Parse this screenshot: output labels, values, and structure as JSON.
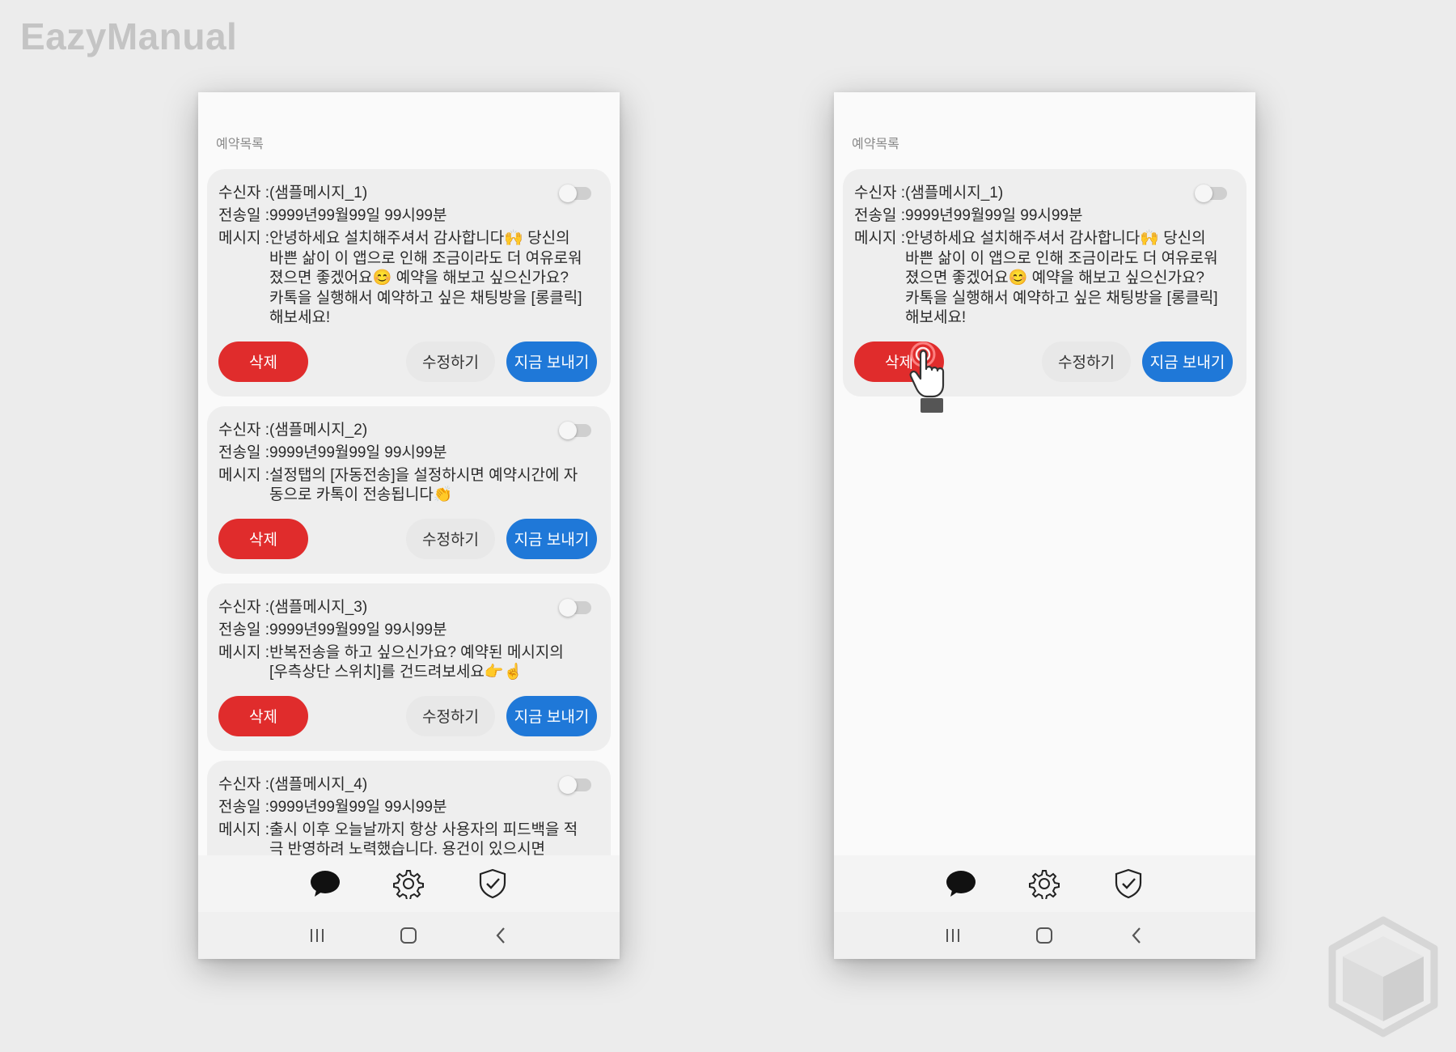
{
  "watermark": "EazyManual",
  "list_title": "예약목록",
  "labels": {
    "recipient": "수신자 : ",
    "date": "전송일 : ",
    "message": "메시지 : "
  },
  "buttons": {
    "delete": "삭제",
    "edit": "수정하기",
    "send_now": "지금 보내기"
  },
  "colors": {
    "delete": "#e02c2c",
    "send_now": "#1f78d8",
    "edit": "#e8e8e8"
  },
  "left_phone": {
    "cards": [
      {
        "recipient": "(샘플메시지_1)",
        "date": "9999년99월99일 99시99분",
        "message": "안녕하세요 설치해주셔서 감사합니다🙌 당신의 바쁜 삶이 이 앱으로 인해 조금이라도 더 여유로워졌으면 좋겠어요😊 예약을 해보고 싶으신가요? 카톡을 실행해서 예약하고 싶은 채팅방을 [롱클릭] 해보세요!",
        "toggle_on": false
      },
      {
        "recipient": "(샘플메시지_2)",
        "date": "9999년99월99일 99시99분",
        "message": "설정탭의 [자동전송]을 설정하시면 예약시간에 자동으로 카톡이 전송됩니다👏",
        "toggle_on": false
      },
      {
        "recipient": "(샘플메시지_3)",
        "date": "9999년99월99일 99시99분",
        "message": "반복전송을 하고 싶으신가요? 예약된 메시지의 [우측상단 스위치]를 건드려보세요👉☝",
        "toggle_on": false
      },
      {
        "recipient": "(샘플메시지_4)",
        "date": "9999년99월99일 99시99분",
        "message": "출시 이후 오늘날까지 항상 사용자의 피드백을 적극 반영하려 노력했습니다. 용건이 있으시면",
        "toggle_on": false
      }
    ]
  },
  "right_phone": {
    "cards": [
      {
        "recipient": "(샘플메시지_1)",
        "date": "9999년99월99일 99시99분",
        "message": "안녕하세요 설치해주셔서 감사합니다🙌 당신의 바쁜 삶이 이 앱으로 인해 조금이라도 더 여유로워졌으면 좋겠어요😊 예약을 해보고 싶으신가요? 카톡을 실행해서 예약하고 싶은 채팅방을 [롱클릭] 해보세요!",
        "toggle_on": false
      }
    ]
  },
  "bottom_nav": [
    "chat-bubble-icon",
    "gear-icon",
    "shield-check-icon"
  ],
  "system_nav": [
    "recent-apps-icon",
    "home-icon",
    "back-icon"
  ]
}
